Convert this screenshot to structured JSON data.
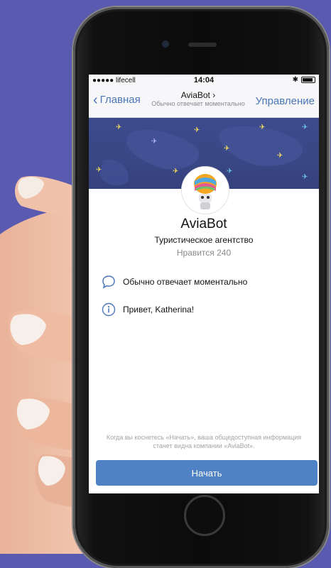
{
  "status_bar": {
    "carrier": "●●●●● lifecell",
    "time": "14:04",
    "bluetooth": "✱"
  },
  "nav": {
    "back_label": "Главная",
    "title": "AviaBot",
    "title_chevron": "›",
    "subtitle": "Обычно отвечает моментально",
    "action_label": "Управление"
  },
  "profile": {
    "name": "AviaBot",
    "category": "Туристическое агентство",
    "likes": "Нравится 240"
  },
  "info": {
    "response_time": "Обычно отвечает моментально",
    "greeting": "Привет, Katherina!"
  },
  "footer": {
    "disclaimer": "Когда вы коснетесь «Начать», ваша общедоступная информация станет видна компании «AviaBot».",
    "start_label": "Начать"
  },
  "colors": {
    "background": "#5a5bb0",
    "accent": "#4a76b8",
    "button": "#4f82c4",
    "cover": "#3c4a8c"
  }
}
